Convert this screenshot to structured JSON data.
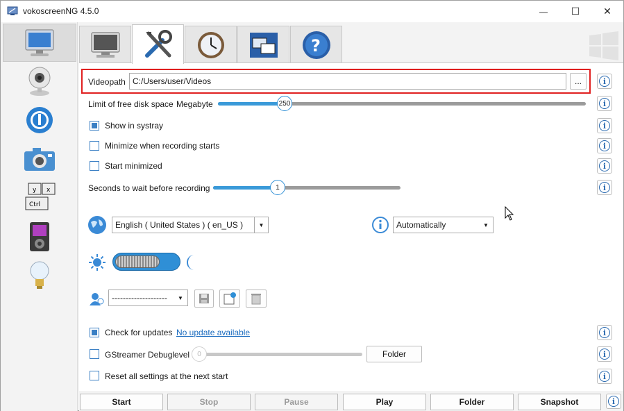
{
  "window": {
    "title": "vokoscreenNG 4.5.0",
    "minimize": "—",
    "maximize": "☐",
    "close": "✕"
  },
  "sidebar": {
    "items": [
      "screencast-icon",
      "webcam-icon",
      "player-icon",
      "camera-icon",
      "showkey-icon",
      "media-player-icon",
      "tips-icon"
    ]
  },
  "tabs": [
    "screen-tab",
    "settings-tab",
    "timer-tab",
    "window-tab",
    "help-tab"
  ],
  "settings": {
    "videopath_label": "Videopath",
    "videopath_value": "C:/Users/user/Videos",
    "browse_label": "...",
    "disk_label": "Limit of free disk space",
    "disk_unit": "Megabyte",
    "disk_value": "250",
    "disk_fraction": 0.18,
    "systray_label": "Show in systray",
    "systray_checked": true,
    "minimize_label": "Minimize when recording starts",
    "minimize_checked": false,
    "start_min_label": "Start minimized",
    "start_min_checked": false,
    "wait_label": "Seconds to wait before recording",
    "wait_value": "1",
    "language_value": "English  ( United States )  ( en_US )",
    "style_value": "Automatically",
    "profile_value": "--------------------",
    "updates_label": "Check for updates",
    "updates_checked": true,
    "updates_link": "No update available",
    "gst_label": "GStreamer Debuglevel",
    "gst_value": "0",
    "gst_checked": false,
    "folder_label": "Folder",
    "reset_label": "Reset all settings at the next start",
    "reset_checked": false,
    "info": "i"
  },
  "bottom": {
    "start": "Start",
    "stop": "Stop",
    "pause": "Pause",
    "play": "Play",
    "folder": "Folder",
    "snapshot": "Snapshot"
  },
  "colors": {
    "accent": "#3a9ad9",
    "highlight": "#e02020",
    "link": "#1a6bbf"
  }
}
